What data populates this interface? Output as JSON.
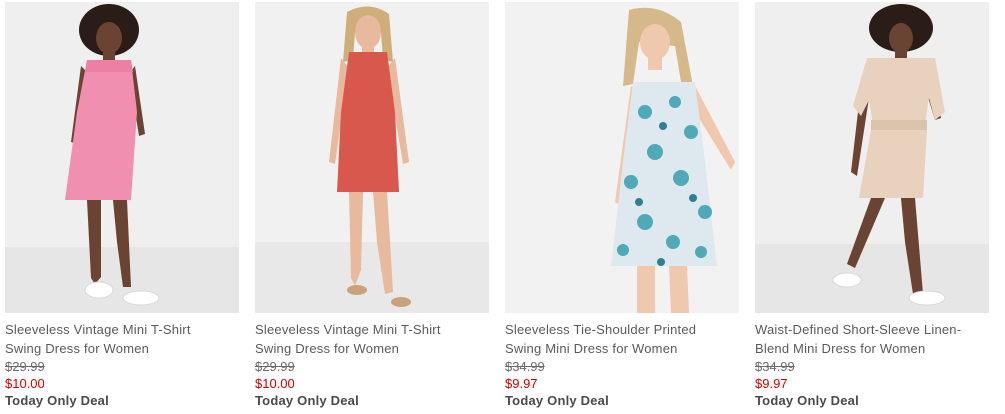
{
  "products": [
    {
      "name_line1": "Sleeveless Vintage Mini T-Shirt",
      "name_line2": "Swing Dress for Women",
      "was_price": "$29.99",
      "now_price": "$10.00",
      "deal": "Today Only Deal"
    },
    {
      "name_line1": "Sleeveless Vintage Mini T-Shirt",
      "name_line2": "Swing Dress for Women",
      "was_price": "$29.99",
      "now_price": "$10.00",
      "deal": "Today Only Deal"
    },
    {
      "name_line1": "Sleeveless Tie-Shoulder Printed",
      "name_line2": "Swing Mini Dress for Women",
      "was_price": "$34.99",
      "now_price": "$9.97",
      "deal": "Today Only Deal"
    },
    {
      "name_line1": "Waist-Defined Short-Sleeve Linen-",
      "name_line2": "Blend Mini Dress for Women",
      "was_price": "$34.99",
      "now_price": "$9.97",
      "deal": "Today Only Deal"
    }
  ],
  "colors": {
    "sale_red": "#cc0000",
    "text_gray": "#5a5a5a",
    "photo_bg": "#ececec",
    "dress_pink": "#f08fb0",
    "dress_coral": "#d9584e",
    "dress_floral_base": "#dde9ee",
    "dress_floral_print": "#4fa9b8",
    "dress_linen": "#e8d2bd"
  }
}
